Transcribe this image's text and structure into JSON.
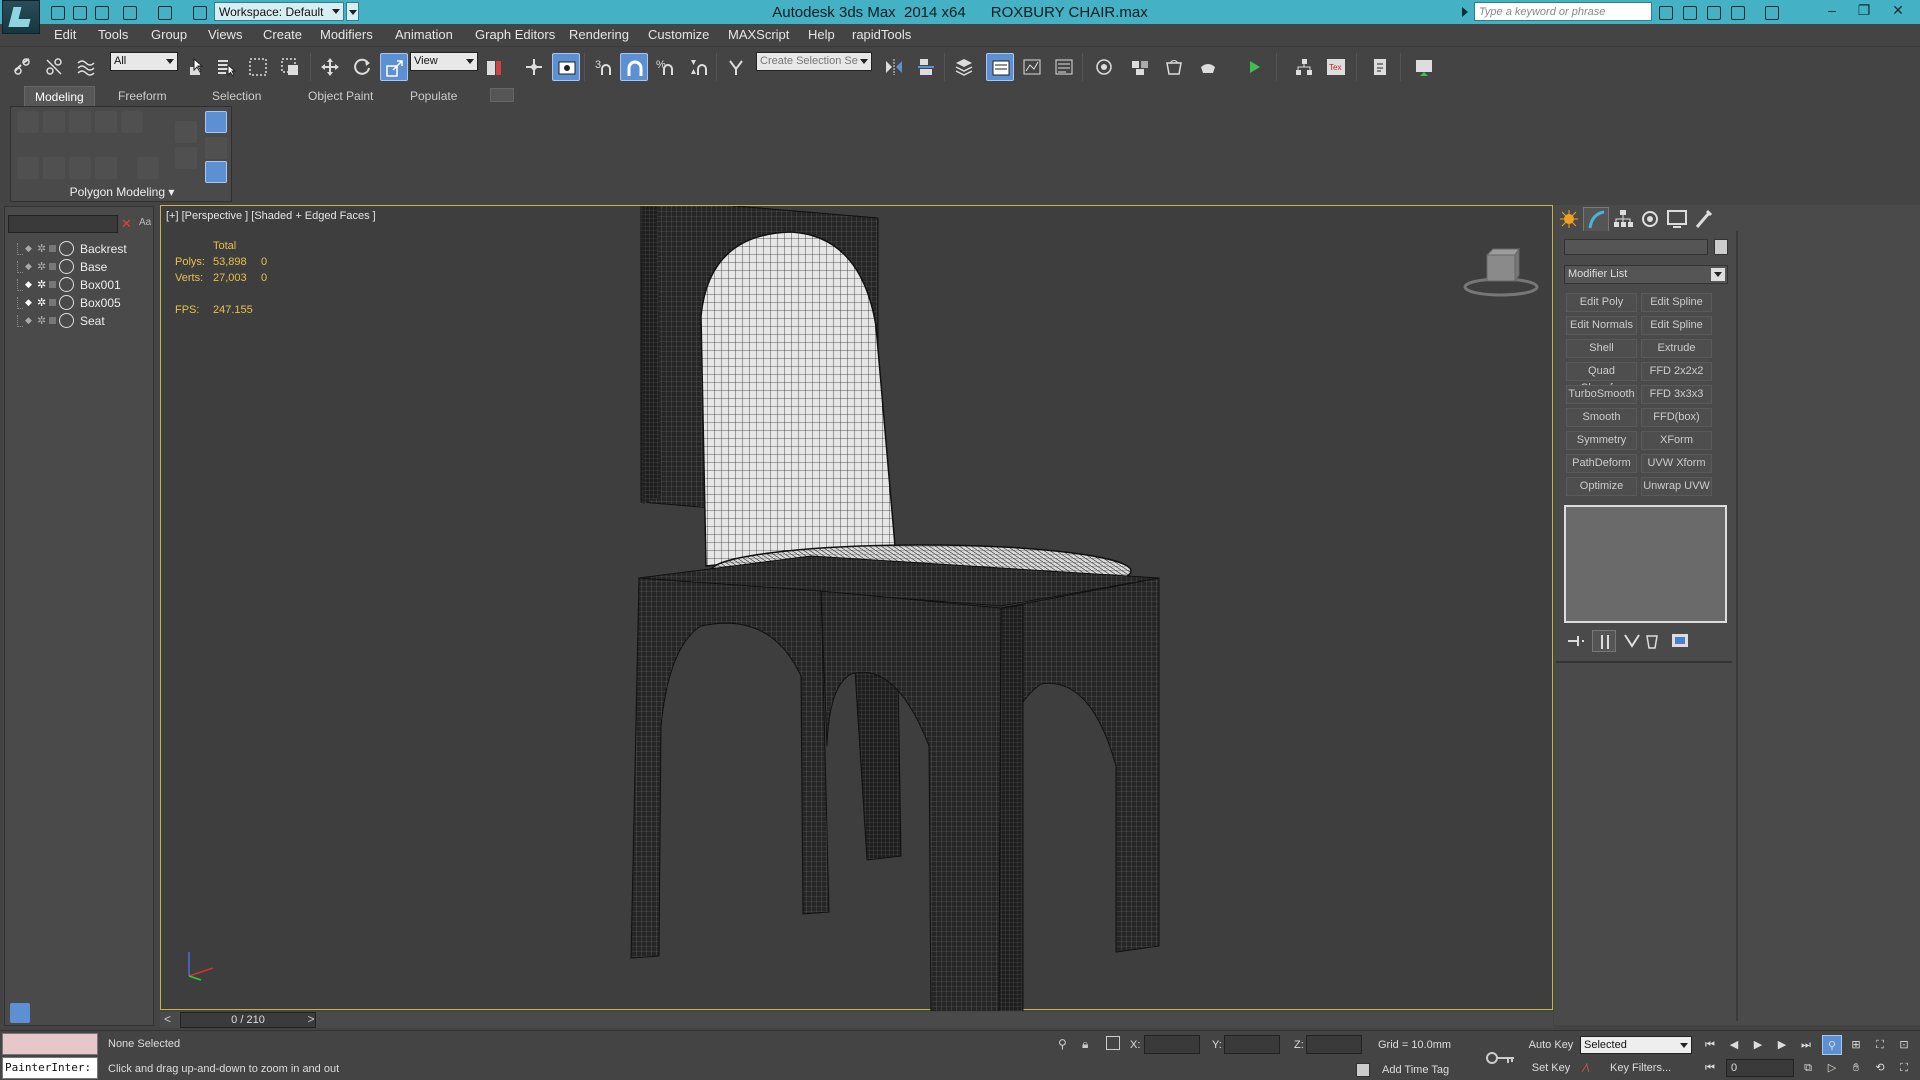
{
  "titlebar": {
    "workspace": "Workspace: Default",
    "app_title": "Autodesk 3ds Max  2014 x64",
    "file_name": "ROXBURY CHAIR.max",
    "search_placeholder": "Type a keyword or phrase",
    "accent": "#45b1c4"
  },
  "menu": [
    "Edit",
    "Tools",
    "Group",
    "Views",
    "Create",
    "Modifiers",
    "Animation",
    "Graph Editors",
    "Rendering",
    "Customize",
    "MAXScript",
    "Help",
    "rapidTools"
  ],
  "toolbar": {
    "selection_filter": "All",
    "reference_coord": "View",
    "named_selection_placeholder": "Create Selection Se",
    "snap_label": "3"
  },
  "ribbon": {
    "tabs": [
      "Modeling",
      "Freeform",
      "Selection",
      "Object Paint",
      "Populate"
    ],
    "active_tab": "Modeling",
    "panel_label": "Polygon Modeling"
  },
  "scene_explorer": {
    "search_value": "",
    "case_label": "Aa",
    "objects": [
      "Backrest",
      "Base",
      "Box001",
      "Box005",
      "Seat"
    ]
  },
  "viewport": {
    "label": "[+] [Perspective ] [Shaded + Edged Faces ]",
    "stats": {
      "header": "Total",
      "polys_label": "Polys:",
      "polys_total": "53,898",
      "polys_selected": "0",
      "verts_label": "Verts:",
      "verts_total": "27,003",
      "verts_selected": "0",
      "fps_label": "FPS:",
      "fps": "247.155"
    },
    "border_color": "#c8b24a"
  },
  "time_slider": {
    "prev": "<",
    "position": "0 / 210",
    "next": ">"
  },
  "command_panel": {
    "modifier_list": "Modifier List",
    "modifier_buttons": [
      [
        "Edit Poly",
        "Edit Spline"
      ],
      [
        "Edit Normals",
        "Edit Spline"
      ],
      [
        "Shell",
        "Extrude"
      ],
      [
        "Quad Chamfer",
        "FFD 2x2x2"
      ],
      [
        "TurboSmooth",
        "FFD 3x3x3"
      ],
      [
        "Smooth",
        "FFD(box)"
      ],
      [
        "Symmetry",
        "XForm"
      ],
      [
        "PathDeform",
        "UVW Xform"
      ],
      [
        "Optimize",
        "Unwrap UVW"
      ]
    ]
  },
  "status": {
    "maxscript_output": "PainterInter:",
    "selection": "None Selected",
    "prompt": "Click and drag up-and-down to zoom in and out",
    "x_label": "X:",
    "y_label": "Y:",
    "z_label": "Z:",
    "grid": "Grid = 10.0mm",
    "add_time_tag": "Add Time Tag",
    "auto_key": "Auto Key",
    "set_key": "Set Key",
    "selection_set": "Selected",
    "key_filters": "Key Filters...",
    "current_frame": "0"
  }
}
